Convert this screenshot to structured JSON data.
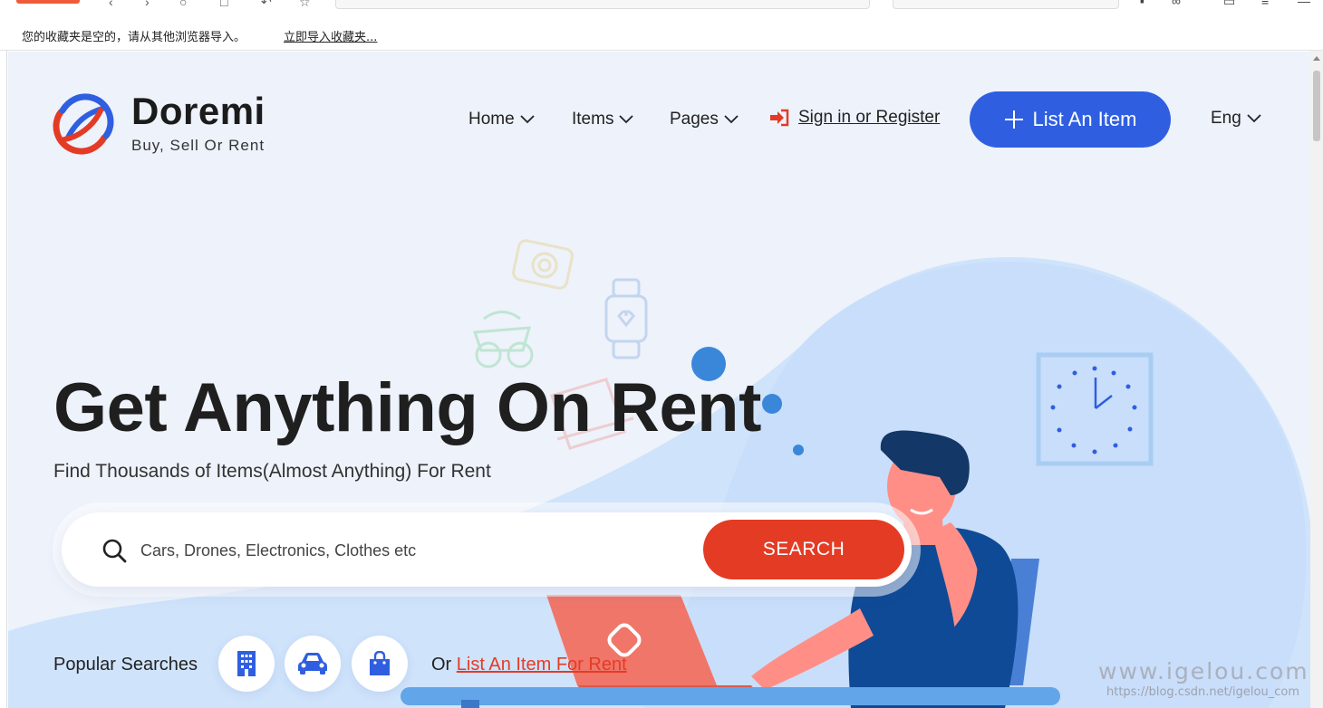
{
  "browser": {
    "bookmarks_message": "您的收藏夹是空的，请从其他浏览器导入。",
    "bookmarks_import_link": "立即导入收藏夹..."
  },
  "brand": {
    "name": "Doremi",
    "tagline": "Buy, Sell Or Rent",
    "colors": {
      "red": "#e43b25",
      "blue": "#2f5fe0",
      "background": "#edf2fb"
    }
  },
  "nav": {
    "items": [
      {
        "label": "Home",
        "icon": "chevron-down-icon"
      },
      {
        "label": "Items",
        "icon": "chevron-down-icon"
      },
      {
        "label": "Pages",
        "icon": "chevron-down-icon"
      }
    ],
    "signin_label": "Sign in or Register",
    "signin_icon": "sign-in-icon",
    "list_button_label": "List An Item",
    "list_button_icon": "plus-icon",
    "language": "Eng"
  },
  "hero": {
    "headline": "Get Anything On Rent",
    "subline": "Find Thousands of Items(Almost Anything) For Rent"
  },
  "search": {
    "placeholder": "Cars, Drones, Electronics, Clothes etc",
    "value": "",
    "button_label": "SEARCH",
    "icon": "search-icon"
  },
  "popular": {
    "label": "Popular Searches",
    "categories": [
      {
        "icon": "building-icon"
      },
      {
        "icon": "car-icon"
      },
      {
        "icon": "shopping-bag-icon"
      }
    ],
    "or_prefix": "Or",
    "list_link": "List An Item For Rent"
  },
  "watermark": {
    "main": "www.igelou.com",
    "sub": "https://blog.csdn.net/igelou_com"
  }
}
